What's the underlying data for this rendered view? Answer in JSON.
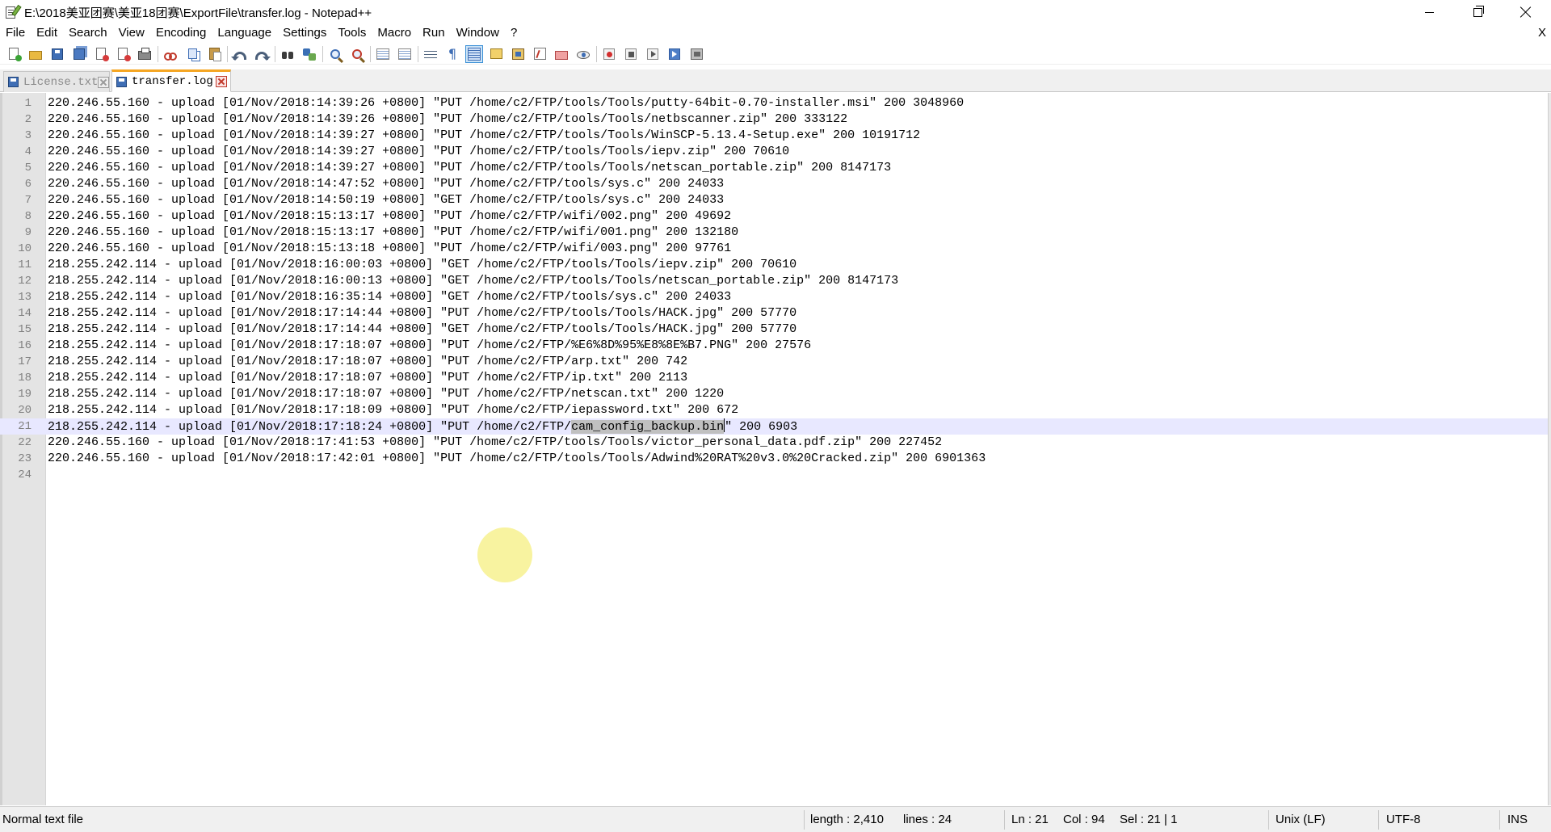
{
  "window": {
    "title": "E:\\2018美亚团赛\\美亚18团赛\\ExportFile\\transfer.log - Notepad++"
  },
  "menu": {
    "items": [
      "File",
      "Edit",
      "Search",
      "View",
      "Encoding",
      "Language",
      "Settings",
      "Tools",
      "Macro",
      "Run",
      "Window",
      "?"
    ],
    "close_label": "X"
  },
  "toolbar": {
    "icons": [
      "new-file-icon",
      "open-file-icon",
      "save-icon",
      "save-all-icon",
      "close-icon",
      "close-all-icon",
      "print-icon",
      "cut-icon",
      "copy-icon",
      "paste-icon",
      "undo-icon",
      "redo-icon",
      "find-icon",
      "replace-icon",
      "zoom-in-icon",
      "zoom-out-icon",
      "sync-vertical-icon",
      "sync-horizontal-icon",
      "word-wrap-icon",
      "show-all-chars-icon",
      "indent-guide-icon",
      "user-defined-lang-icon",
      "doc-map-icon",
      "function-list-icon",
      "folder-as-workspace-icon",
      "monitoring-icon",
      "record-macro-icon",
      "stop-macro-icon",
      "play-macro-icon",
      "run-macro-multiple-icon",
      "save-macro-icon"
    ]
  },
  "tabs": [
    {
      "label": "License.txt",
      "active": false
    },
    {
      "label": "transfer.log",
      "active": true
    }
  ],
  "editor": {
    "current_line": 21,
    "lines": [
      "220.246.55.160 - upload [01/Nov/2018:14:39:26 +0800] \"PUT /home/c2/FTP/tools/Tools/putty-64bit-0.70-installer.msi\" 200 3048960",
      "220.246.55.160 - upload [01/Nov/2018:14:39:26 +0800] \"PUT /home/c2/FTP/tools/Tools/netbscanner.zip\" 200 333122",
      "220.246.55.160 - upload [01/Nov/2018:14:39:27 +0800] \"PUT /home/c2/FTP/tools/Tools/WinSCP-5.13.4-Setup.exe\" 200 10191712",
      "220.246.55.160 - upload [01/Nov/2018:14:39:27 +0800] \"PUT /home/c2/FTP/tools/Tools/iepv.zip\" 200 70610",
      "220.246.55.160 - upload [01/Nov/2018:14:39:27 +0800] \"PUT /home/c2/FTP/tools/Tools/netscan_portable.zip\" 200 8147173",
      "220.246.55.160 - upload [01/Nov/2018:14:47:52 +0800] \"PUT /home/c2/FTP/tools/sys.c\" 200 24033",
      "220.246.55.160 - upload [01/Nov/2018:14:50:19 +0800] \"GET /home/c2/FTP/tools/sys.c\" 200 24033",
      "220.246.55.160 - upload [01/Nov/2018:15:13:17 +0800] \"PUT /home/c2/FTP/wifi/002.png\" 200 49692",
      "220.246.55.160 - upload [01/Nov/2018:15:13:17 +0800] \"PUT /home/c2/FTP/wifi/001.png\" 200 132180",
      "220.246.55.160 - upload [01/Nov/2018:15:13:18 +0800] \"PUT /home/c2/FTP/wifi/003.png\" 200 97761",
      "218.255.242.114 - upload [01/Nov/2018:16:00:03 +0800] \"GET /home/c2/FTP/tools/Tools/iepv.zip\" 200 70610",
      "218.255.242.114 - upload [01/Nov/2018:16:00:13 +0800] \"GET /home/c2/FTP/tools/Tools/netscan_portable.zip\" 200 8147173",
      "218.255.242.114 - upload [01/Nov/2018:16:35:14 +0800] \"GET /home/c2/FTP/tools/sys.c\" 200 24033",
      "218.255.242.114 - upload [01/Nov/2018:17:14:44 +0800] \"PUT /home/c2/FTP/tools/Tools/HACK.jpg\" 200 57770",
      "218.255.242.114 - upload [01/Nov/2018:17:14:44 +0800] \"GET /home/c2/FTP/tools/Tools/HACK.jpg\" 200 57770",
      "218.255.242.114 - upload [01/Nov/2018:17:18:07 +0800] \"PUT /home/c2/FTP/%E6%8D%95%E8%8E%B7.PNG\" 200 27576",
      "218.255.242.114 - upload [01/Nov/2018:17:18:07 +0800] \"PUT /home/c2/FTP/arp.txt\" 200 742",
      "218.255.242.114 - upload [01/Nov/2018:17:18:07 +0800] \"PUT /home/c2/FTP/ip.txt\" 200 2113",
      "218.255.242.114 - upload [01/Nov/2018:17:18:07 +0800] \"PUT /home/c2/FTP/netscan.txt\" 200 1220",
      "218.255.242.114 - upload [01/Nov/2018:17:18:09 +0800] \"PUT /home/c2/FTP/iepassword.txt\" 200 672",
      "218.255.242.114 - upload [01/Nov/2018:17:18:24 +0800] \"PUT /home/c2/FTP/cam_config_backup.bin\" 200 6903",
      "220.246.55.160 - upload [01/Nov/2018:17:41:53 +0800] \"PUT /home/c2/FTP/tools/Tools/victor_personal_data.pdf.zip\" 200 227452",
      "220.246.55.160 - upload [01/Nov/2018:17:42:01 +0800] \"PUT /home/c2/FTP/tools/Tools/Adwind%20RAT%20v3.0%20Cracked.zip\" 200 6901363",
      ""
    ],
    "selection": {
      "line": 21,
      "before": "218.255.242.114 - upload [01/Nov/2018:17:18:24 +0800] \"PUT /home/c2/FTP/",
      "selected": "cam_config_backup.bin",
      "after": "\" 200 6903"
    }
  },
  "status": {
    "file_type": "Normal text file",
    "length": "length : 2,410",
    "lines": "lines : 24",
    "ln": "Ln : 21",
    "col": "Col : 94",
    "sel": "Sel : 21 | 1",
    "eol": "Unix (LF)",
    "encoding": "UTF-8",
    "mode": "INS"
  }
}
